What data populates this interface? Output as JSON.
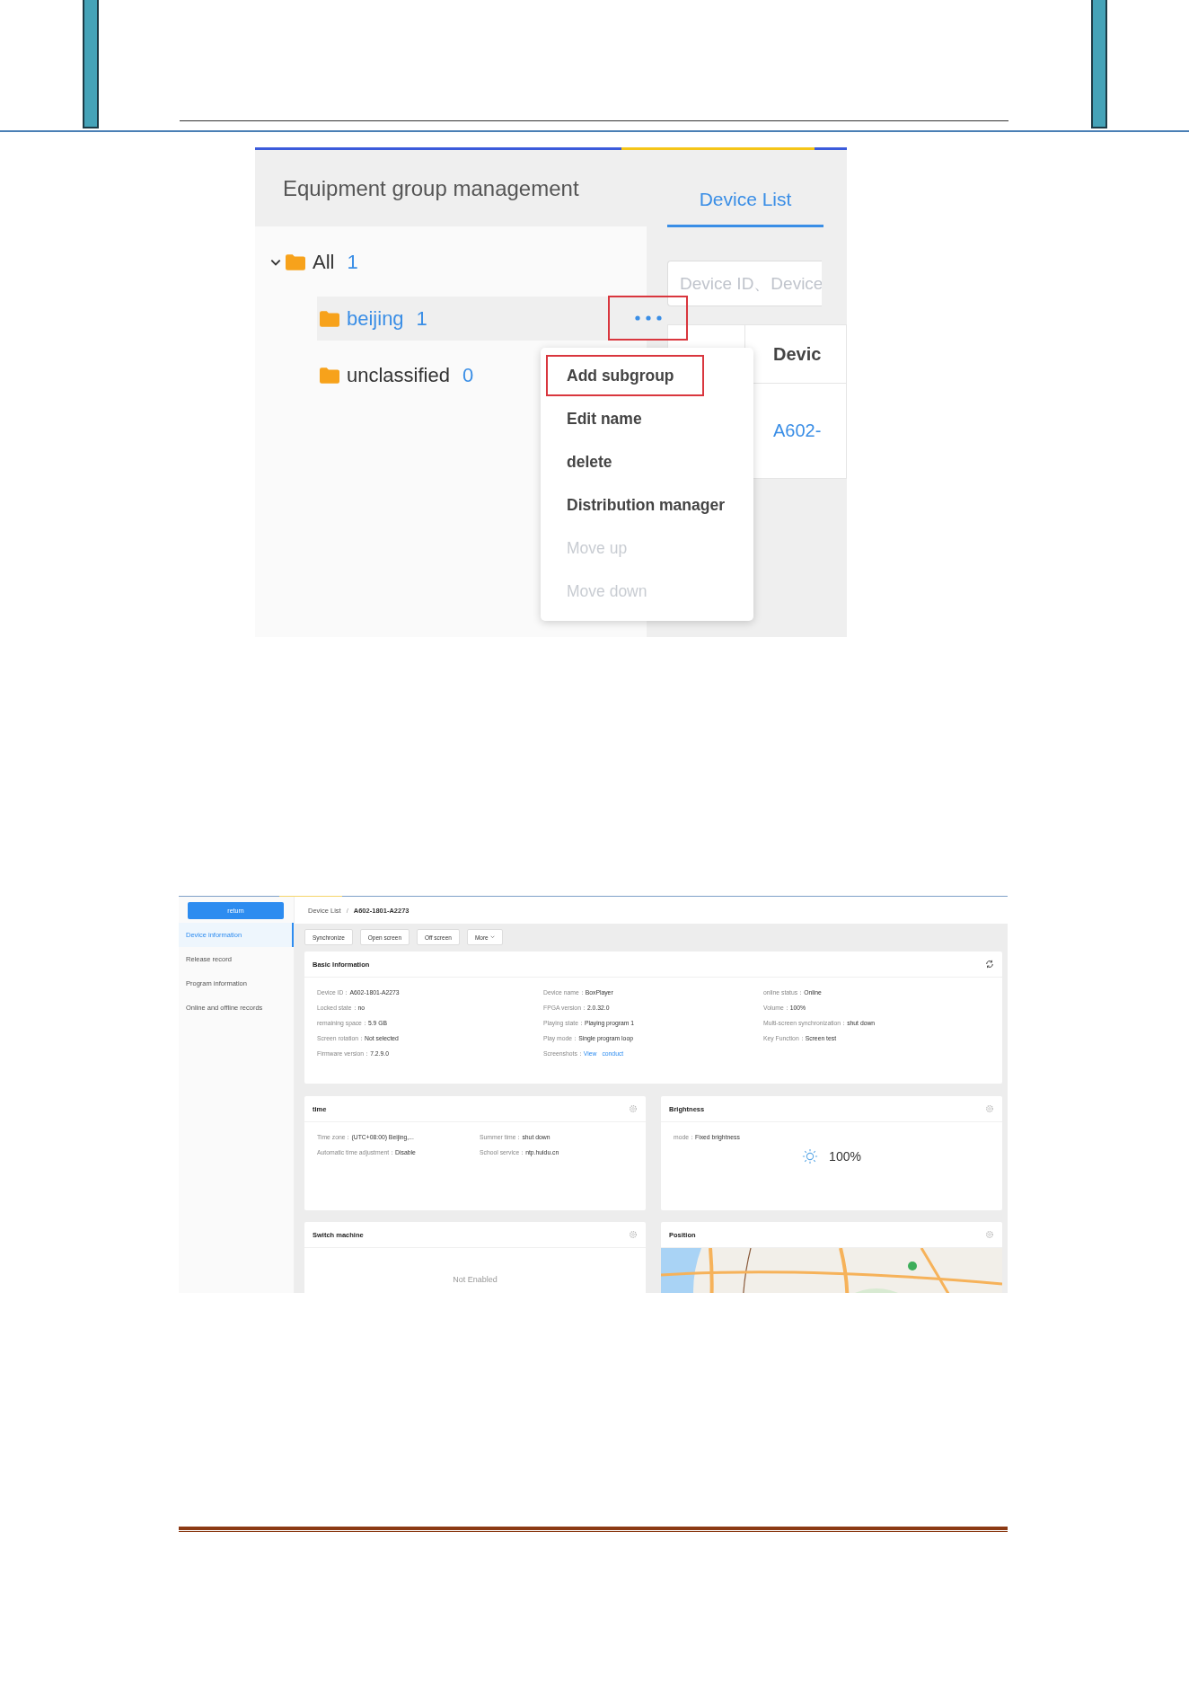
{
  "group_panel": {
    "title": "Equipment group management",
    "tree": [
      {
        "label": "All",
        "count": "1",
        "expanded": true,
        "selected": false,
        "children": [
          {
            "label": "beijing",
            "count": "1",
            "selected": true
          },
          {
            "label": "unclassified",
            "count": "0",
            "selected": false
          }
        ]
      }
    ],
    "more_button": {
      "annotated": true
    },
    "context_menu": [
      {
        "label": "Add subgroup",
        "disabled": false,
        "annotated": true
      },
      {
        "label": "Edit name",
        "disabled": false,
        "annotated": false
      },
      {
        "label": "delete",
        "disabled": false,
        "annotated": false
      },
      {
        "label": "Distribution manager",
        "disabled": false,
        "annotated": false
      },
      {
        "label": "Move up",
        "disabled": true,
        "annotated": false
      },
      {
        "label": "Move down",
        "disabled": true,
        "annotated": false
      }
    ]
  },
  "device_panel": {
    "tab": "Device List",
    "search": {
      "placeholder": "Device ID、Device"
    },
    "table": {
      "columns": [
        "Devic"
      ],
      "rows": [
        [
          "A602-"
        ]
      ]
    }
  },
  "device_detail": {
    "return_button": "return",
    "nav": [
      {
        "label": "Device information",
        "selected": true
      },
      {
        "label": "Release record",
        "selected": false
      },
      {
        "label": "Program information",
        "selected": false
      },
      {
        "label": "Online and offline records",
        "selected": false
      }
    ],
    "breadcrumb": [
      "Device List",
      "A602-1801-A2273"
    ],
    "breadcrumb_separator": "/",
    "actions": [
      "Synchronize",
      "Open screen",
      "Off screen"
    ],
    "more_action": "More",
    "basic_info": {
      "title": "Basic Information",
      "columns": [
        [
          {
            "label": "Device ID：",
            "value": "A602-1801-A2273"
          },
          {
            "label": "Locked state：",
            "value": "no"
          },
          {
            "label": "remaining space：",
            "value": "5.9 GB"
          },
          {
            "label": "Screen rotation：",
            "value": "Not selected"
          },
          {
            "label": "Firmware version：",
            "value": "7.2.9.0"
          }
        ],
        [
          {
            "label": "Device name：",
            "value": "BoxPlayer"
          },
          {
            "label": "FPGA version：",
            "value": "2.0.32.0"
          },
          {
            "label": "Playing state：",
            "value": "Playing program 1"
          },
          {
            "label": "Play mode：",
            "value": "Single program loop"
          },
          {
            "label": "Screenshots：",
            "links": [
              "View",
              "conduct"
            ]
          }
        ],
        [
          {
            "label": "online status：",
            "value": "Online"
          },
          {
            "label": "Volume：",
            "value": "100%"
          },
          {
            "label": "Multi-screen synchronization：",
            "value": "shut down"
          },
          {
            "label": "Key Function：",
            "value": "Screen test"
          }
        ]
      ]
    },
    "time": {
      "title": "time",
      "columns": [
        [
          {
            "label": "Time zone：",
            "value": "(UTC+08:00) Beijing,..."
          },
          {
            "label": "Automatic time adjustment：",
            "value": "Disable"
          }
        ],
        [
          {
            "label": "Summer time：",
            "value": "shut down"
          },
          {
            "label": "School service：",
            "value": "ntp.huidu.cn"
          }
        ]
      ]
    },
    "brightness": {
      "title": "Brightness",
      "mode": {
        "label": "mode：",
        "value": "Fixed brightness"
      },
      "reading": "100%"
    },
    "switch_machine": {
      "title": "Switch machine",
      "status": "Not Enabled"
    },
    "position": {
      "title": "Position"
    }
  }
}
